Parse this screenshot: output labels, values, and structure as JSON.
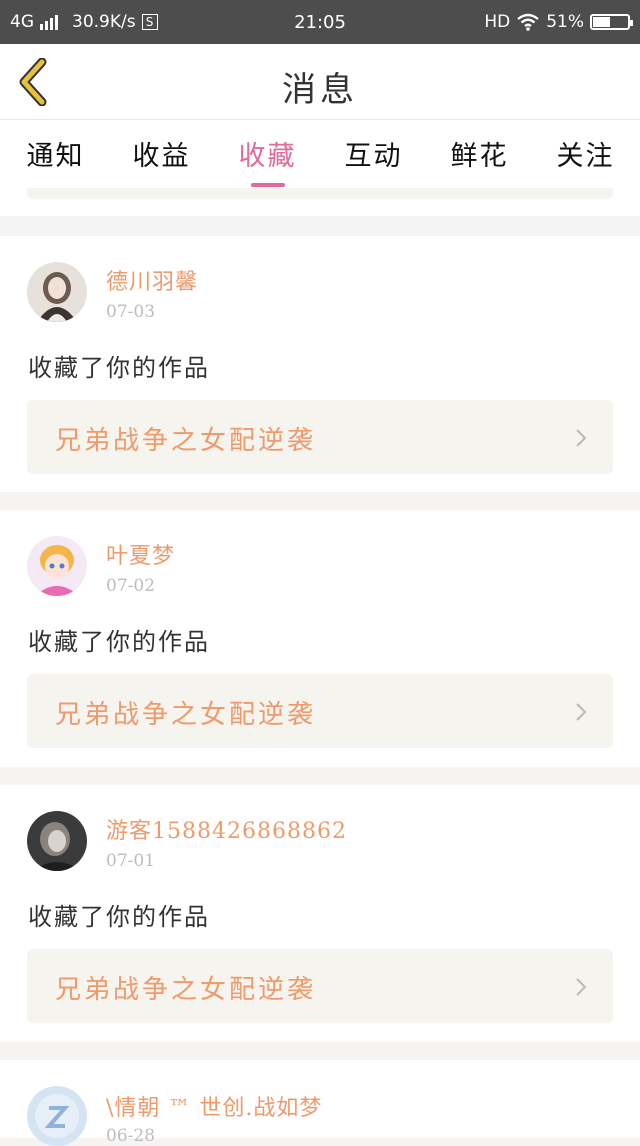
{
  "status_bar": {
    "network": "4G",
    "speed": "30.9K/s",
    "s_badge": "S",
    "time": "21:05",
    "hd": "HD",
    "battery_text": "51%",
    "battery_level": 0.51
  },
  "nav": {
    "title": "消息",
    "back_icon": "chevron-left-icon"
  },
  "tabs": [
    {
      "label": "通知"
    },
    {
      "label": "收益"
    },
    {
      "label": "收藏",
      "active": true
    },
    {
      "label": "互动"
    },
    {
      "label": "鲜花"
    },
    {
      "label": "关注"
    }
  ],
  "colors": {
    "accent_pink": "#e06b9a",
    "accent_orange": "#ef9a6b",
    "back_yellow": "#e8c23a"
  },
  "messages": [
    {
      "user": "德川羽馨",
      "date": "07-03",
      "action": "收藏了你的作品",
      "work": "兄弟战争之女配逆袭"
    },
    {
      "user": "叶夏梦",
      "date": "07-02",
      "action": "收藏了你的作品",
      "work": "兄弟战争之女配逆袭"
    },
    {
      "user": "游客1588426868862",
      "date": "07-01",
      "action": "收藏了你的作品",
      "work": "兄弟战争之女配逆袭"
    },
    {
      "user": "\\情朝 ™ 世创.战如梦",
      "date": "06-28"
    }
  ]
}
